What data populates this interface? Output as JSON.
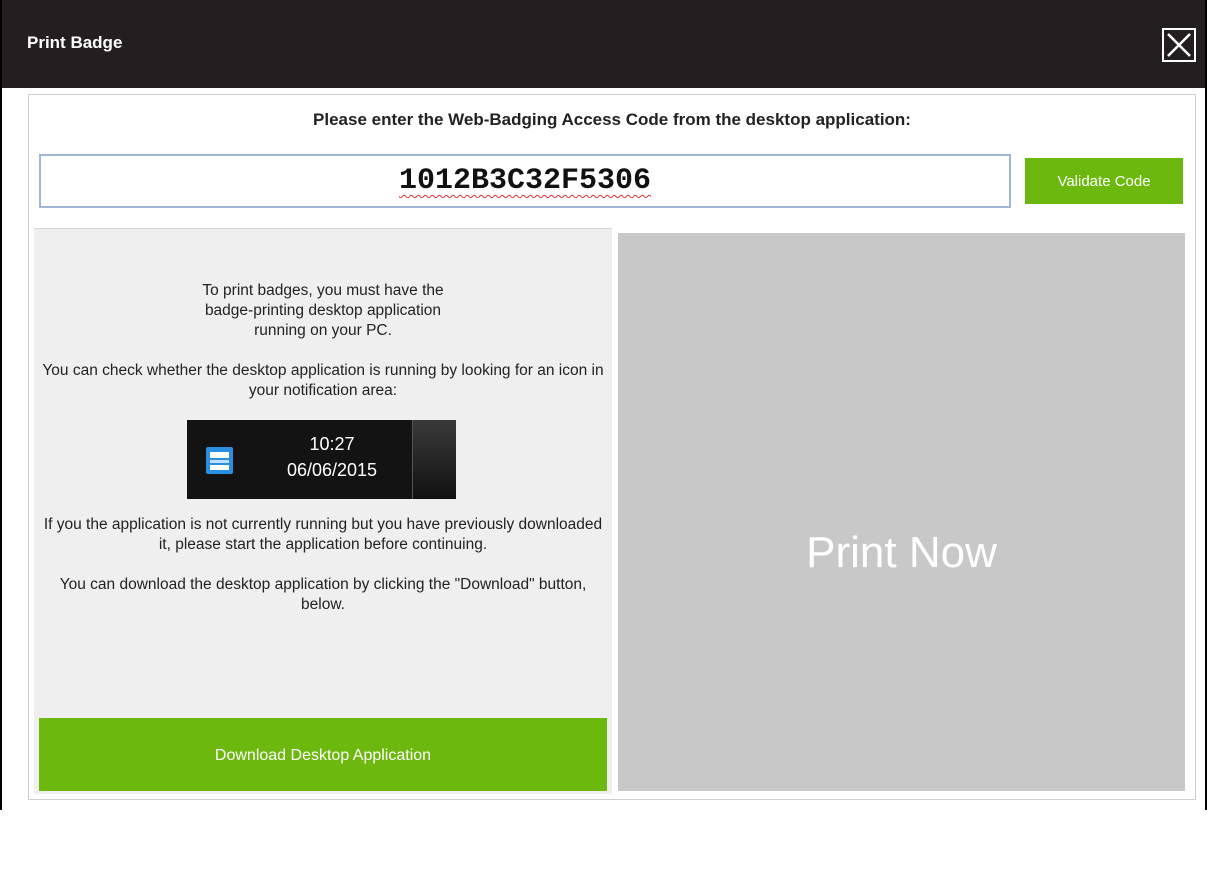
{
  "dialog": {
    "title": "Print Badge"
  },
  "access_code": {
    "prompt": "Please enter the Web-Badging Access Code from the desktop application:",
    "value": "1012B3C32F5306",
    "validate_label": "Validate Code"
  },
  "info": {
    "paragraph_1": "To print badges, you must have the badge-printing desktop application running on your PC.",
    "paragraph_2": "You can check whether the desktop application is running by looking for an icon in your notification area:",
    "paragraph_3": "If you the application is not currently running but you have previously downloaded it, please start the application before continuing.",
    "paragraph_4": "You can download the desktop application by clicking the \"Download\" button, below."
  },
  "tray_example": {
    "time": "10:27",
    "date": "06/06/2015",
    "icon": "printer-icon"
  },
  "buttons": {
    "download_label": "Download Desktop Application",
    "print_label": "Print Now"
  },
  "colors": {
    "titlebar": "#231f20",
    "accent_green": "#6cb80e",
    "print_panel": "#c8c8c8"
  }
}
